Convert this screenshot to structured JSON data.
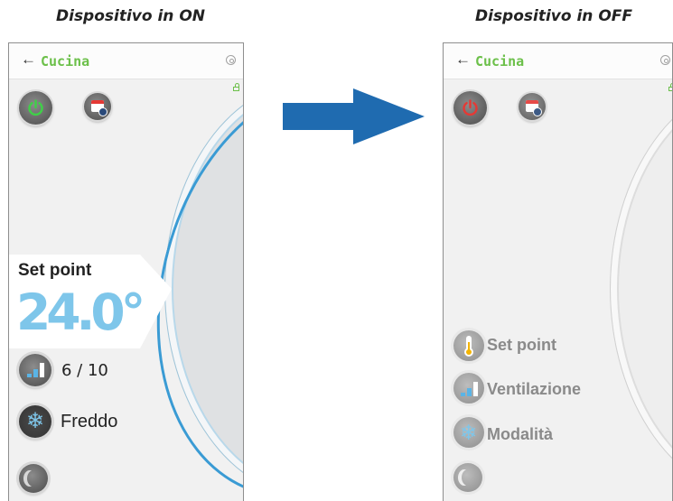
{
  "captions": {
    "left": "Dispositivo in ON",
    "right": "Dispositivo in OFF"
  },
  "on": {
    "title": "Cucina",
    "set_point_label": "Set point",
    "temperature": "24.0°",
    "fan_value": "6 / 10",
    "mode_value": "Freddo",
    "icons": [
      "back-arrow-icon",
      "gear-icon",
      "lock-icon",
      "power-icon",
      "calendar-icon",
      "fan-bars-icon",
      "snowflake-icon",
      "moon-icon"
    ]
  },
  "off": {
    "title": "Cucina",
    "set_point_label": "Set point",
    "ventilation_label": "Ventilazione",
    "mode_label": "Modalità",
    "icons": [
      "back-arrow-icon",
      "gear-icon",
      "lock-icon",
      "power-icon",
      "calendar-icon",
      "thermometer-icon",
      "fan-bars-icon",
      "snowflake-icon",
      "moon-icon"
    ]
  },
  "colors": {
    "accent_green": "#6cc04a",
    "temp_blue": "#7ec6ea",
    "arrow_blue": "#1f6bb0",
    "power_on": "#3fcf48",
    "power_off": "#e53935"
  }
}
